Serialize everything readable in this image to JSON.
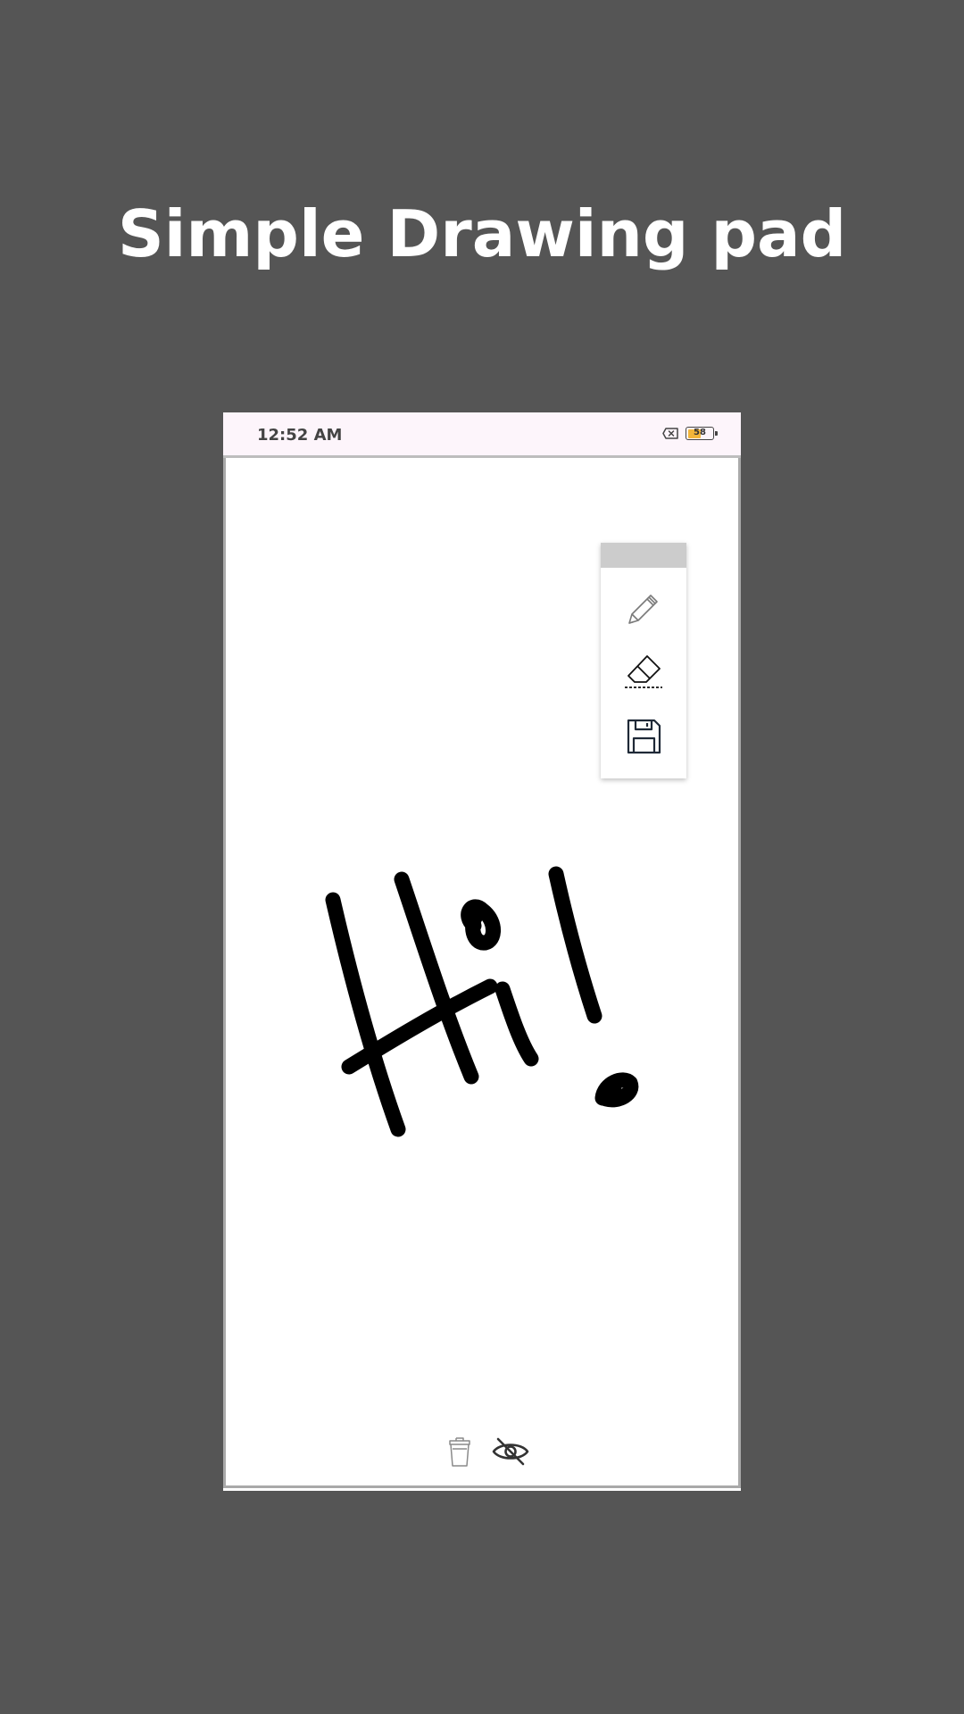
{
  "headline": "Simple Drawing pad",
  "status_bar": {
    "time": "12:52 AM",
    "battery_level": "58",
    "battery_percent": 58,
    "icons": [
      "sim-x-icon",
      "battery-icon"
    ]
  },
  "toolbar": {
    "tools": [
      {
        "name": "pencil",
        "icon": "pencil-icon"
      },
      {
        "name": "eraser",
        "icon": "eraser-icon"
      },
      {
        "name": "save",
        "icon": "save-icon"
      }
    ]
  },
  "bottom_controls": [
    {
      "name": "clear",
      "icon": "trash-icon"
    },
    {
      "name": "hide",
      "icon": "eye-off-icon"
    }
  ],
  "colors": {
    "background": "#555555",
    "headline": "#ffffff",
    "ink": "#000000",
    "battery": "#f2b53a",
    "toolbar_handle": "#cccccc",
    "status_bar": "#fdf5fb"
  }
}
